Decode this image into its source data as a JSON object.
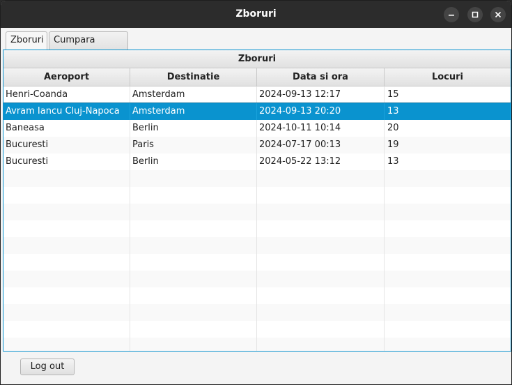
{
  "window": {
    "title": "Zboruri"
  },
  "tabs": [
    {
      "label": "Zboruri",
      "active": true
    },
    {
      "label": "Cumpara bilete",
      "active": false
    }
  ],
  "table": {
    "caption": "Zboruri",
    "columns": [
      "Aeroport",
      "Destinatie",
      "Data si ora",
      "Locuri"
    ],
    "rows": [
      [
        "Henri-Coanda",
        "Amsterdam",
        "2024-09-13 12:17",
        "15"
      ],
      [
        "Avram Iancu Cluj-Napoca",
        "Amsterdam",
        "2024-09-13 20:20",
        "13"
      ],
      [
        "Baneasa",
        "Berlin",
        "2024-10-11 10:14",
        "20"
      ],
      [
        "Bucuresti",
        "Paris",
        "2024-07-17 00:13",
        "19"
      ],
      [
        "Bucuresti",
        "Berlin",
        "2024-05-22 13:12",
        "13"
      ]
    ],
    "selected_row": 1,
    "empty_rows": 11
  },
  "footer": {
    "logout_label": "Log out"
  },
  "colors": {
    "accent": "#0a93cf",
    "titlebar": "#2c2c2c"
  },
  "icons": {
    "minimize": "minimize-icon",
    "maximize": "maximize-icon",
    "close": "close-icon"
  }
}
